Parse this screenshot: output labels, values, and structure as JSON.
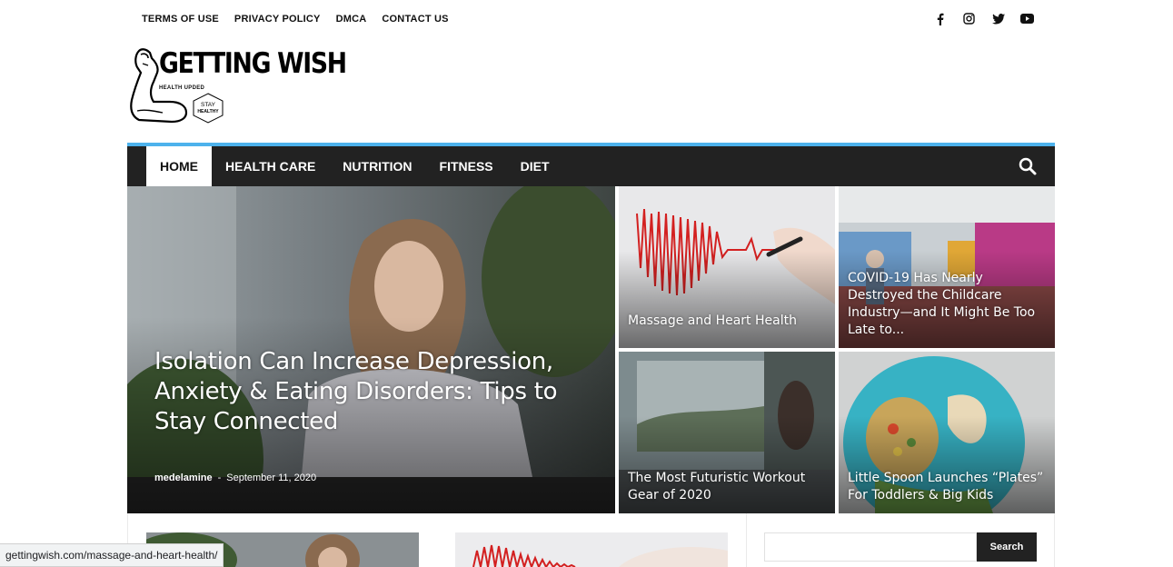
{
  "top_links": [
    "TERMS OF USE",
    "PRIVACY POLICY",
    "DMCA",
    "CONTACT US"
  ],
  "social_icons": [
    "facebook-icon",
    "instagram-icon",
    "twitter-icon",
    "youtube-icon"
  ],
  "logo": {
    "title": "GETTING WISH",
    "subtitle": "HEALTH UPDED",
    "badge_line1": "STAY",
    "badge_line2": "HEALTHY"
  },
  "nav": {
    "items": [
      "HOME",
      "HEALTH CARE",
      "NUTRITION",
      "FITNESS",
      "DIET"
    ],
    "active": "HOME",
    "accent_color": "#4db2ec"
  },
  "featured": {
    "main": {
      "title": "Isolation Can Increase Depression, Anxiety & Eating Disorders: Tips to Stay Connected",
      "author": "medelamine",
      "separator": "-",
      "date": "September 11, 2020"
    },
    "tiles": [
      {
        "title": "Massage and Heart Health"
      },
      {
        "title": "COVID-19 Has Nearly Destroyed the Childcare Industry—and It Might Be Too Late to..."
      },
      {
        "title": "The Most Futuristic Workout Gear of 2020"
      },
      {
        "title": "Little Spoon Launches “Plates” For Toddlers & Big Kids"
      }
    ]
  },
  "sidebar": {
    "search_button": "Search",
    "search_value": ""
  },
  "status_bar": {
    "url": "gettingwish.com/massage-and-heart-health/"
  }
}
